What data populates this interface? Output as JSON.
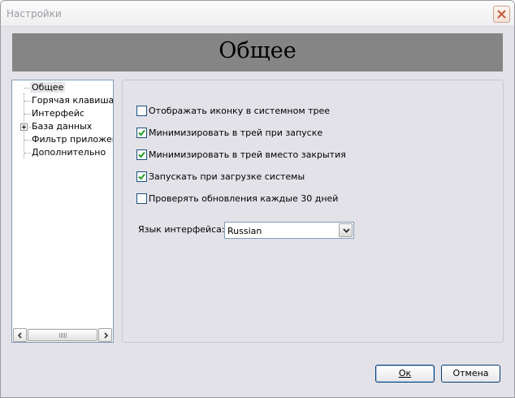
{
  "window": {
    "title": "Настройки"
  },
  "header": {
    "title": "Общее"
  },
  "tree": {
    "items": [
      {
        "label": "Общее",
        "selected": true,
        "expandable": false
      },
      {
        "label": "Горячая клавиша",
        "selected": false,
        "expandable": false
      },
      {
        "label": "Интерфейс",
        "selected": false,
        "expandable": false
      },
      {
        "label": "База данных",
        "selected": false,
        "expandable": true
      },
      {
        "label": "Фильтр приложени",
        "selected": false,
        "expandable": false
      },
      {
        "label": "Дополнительно",
        "selected": false,
        "expandable": false
      }
    ]
  },
  "general": {
    "options": [
      {
        "label": "Отображать иконку в системном трее",
        "checked": false
      },
      {
        "label": "Минимизировать в трей при запуске",
        "checked": true
      },
      {
        "label": "Минимизировать в трей вместо закрытия",
        "checked": true
      },
      {
        "label": "Запускать при загрузке системы",
        "checked": true
      },
      {
        "label": "Проверять обновления каждые 30 дней",
        "checked": false
      }
    ],
    "language_label": "Язык интерфейса:",
    "language_value": "Russian"
  },
  "buttons": {
    "ok": "Ок",
    "cancel": "Отмена"
  },
  "colors": {
    "header_band": "#858585",
    "check_mark": "#21a121",
    "window_bg": "#e3e2e8"
  }
}
